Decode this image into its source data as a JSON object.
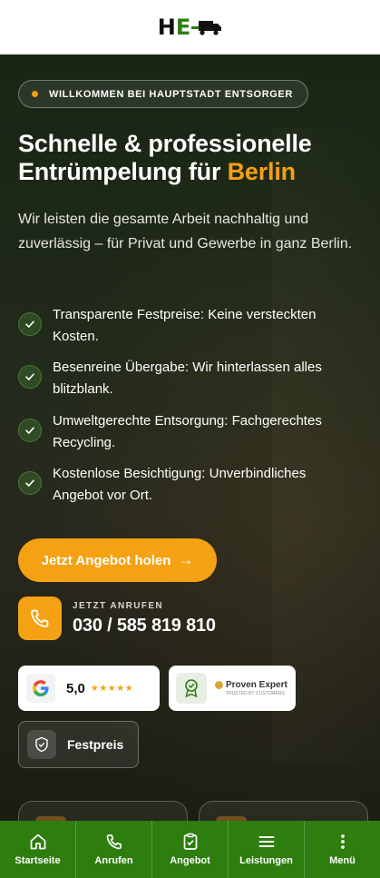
{
  "header": {
    "logo_text_h": "H",
    "logo_text_e": "E",
    "logo_truck_icon": "truck-icon"
  },
  "hero": {
    "badge": "WILLKOMMEN BEI HAUPTSTADT ENTSORGER",
    "title_part1": "Schnelle & professionelle Entrümpelung für ",
    "title_highlight": "Berlin",
    "intro": "Wir leisten die gesamte Arbeit nachhaltig und zuverlässig – für Privat und Gewerbe in ganz Berlin.",
    "features": [
      {
        "icon": "check-icon",
        "text": "Transparente Festpreise: Keine versteckten Kosten."
      },
      {
        "icon": "check-icon",
        "text": "Besenreine Übergabe: Wir hinterlassen alles blitzblank."
      },
      {
        "icon": "check-icon",
        "text": "Umweltgerechte Entsorgung: Fachgerechtes Recycling."
      },
      {
        "icon": "check-icon",
        "text": "Kostenlose Besichtigung: Unverbindliches Angebot vor Ort."
      }
    ],
    "cta_label": "Jetzt Angebot holen",
    "cta_arrow": "→",
    "call_label": "JETZT ANRUFEN",
    "call_number": "030 / 585 819 810"
  },
  "trust": {
    "google_score": "5,0",
    "google_stars": "★★★★★",
    "google_rating": 5,
    "provenexpert_name": "Proven Expert",
    "provenexpert_sub": "TRUSTED BY CUSTOMERS",
    "fixed_price_label": "Festpreis"
  },
  "colors": {
    "accent": "#f5a114",
    "brand_green": "#2e7d0f",
    "header_bg": "#ffffff"
  },
  "nav": {
    "items": [
      {
        "label": "Startseite",
        "icon": "home-icon"
      },
      {
        "label": "Anrufen",
        "icon": "phone-icon"
      },
      {
        "label": "Angebot",
        "icon": "clipboard-check-icon"
      },
      {
        "label": "Leistungen",
        "icon": "menu-lines-icon"
      },
      {
        "label": "Menü",
        "icon": "more-vertical-icon"
      }
    ]
  }
}
